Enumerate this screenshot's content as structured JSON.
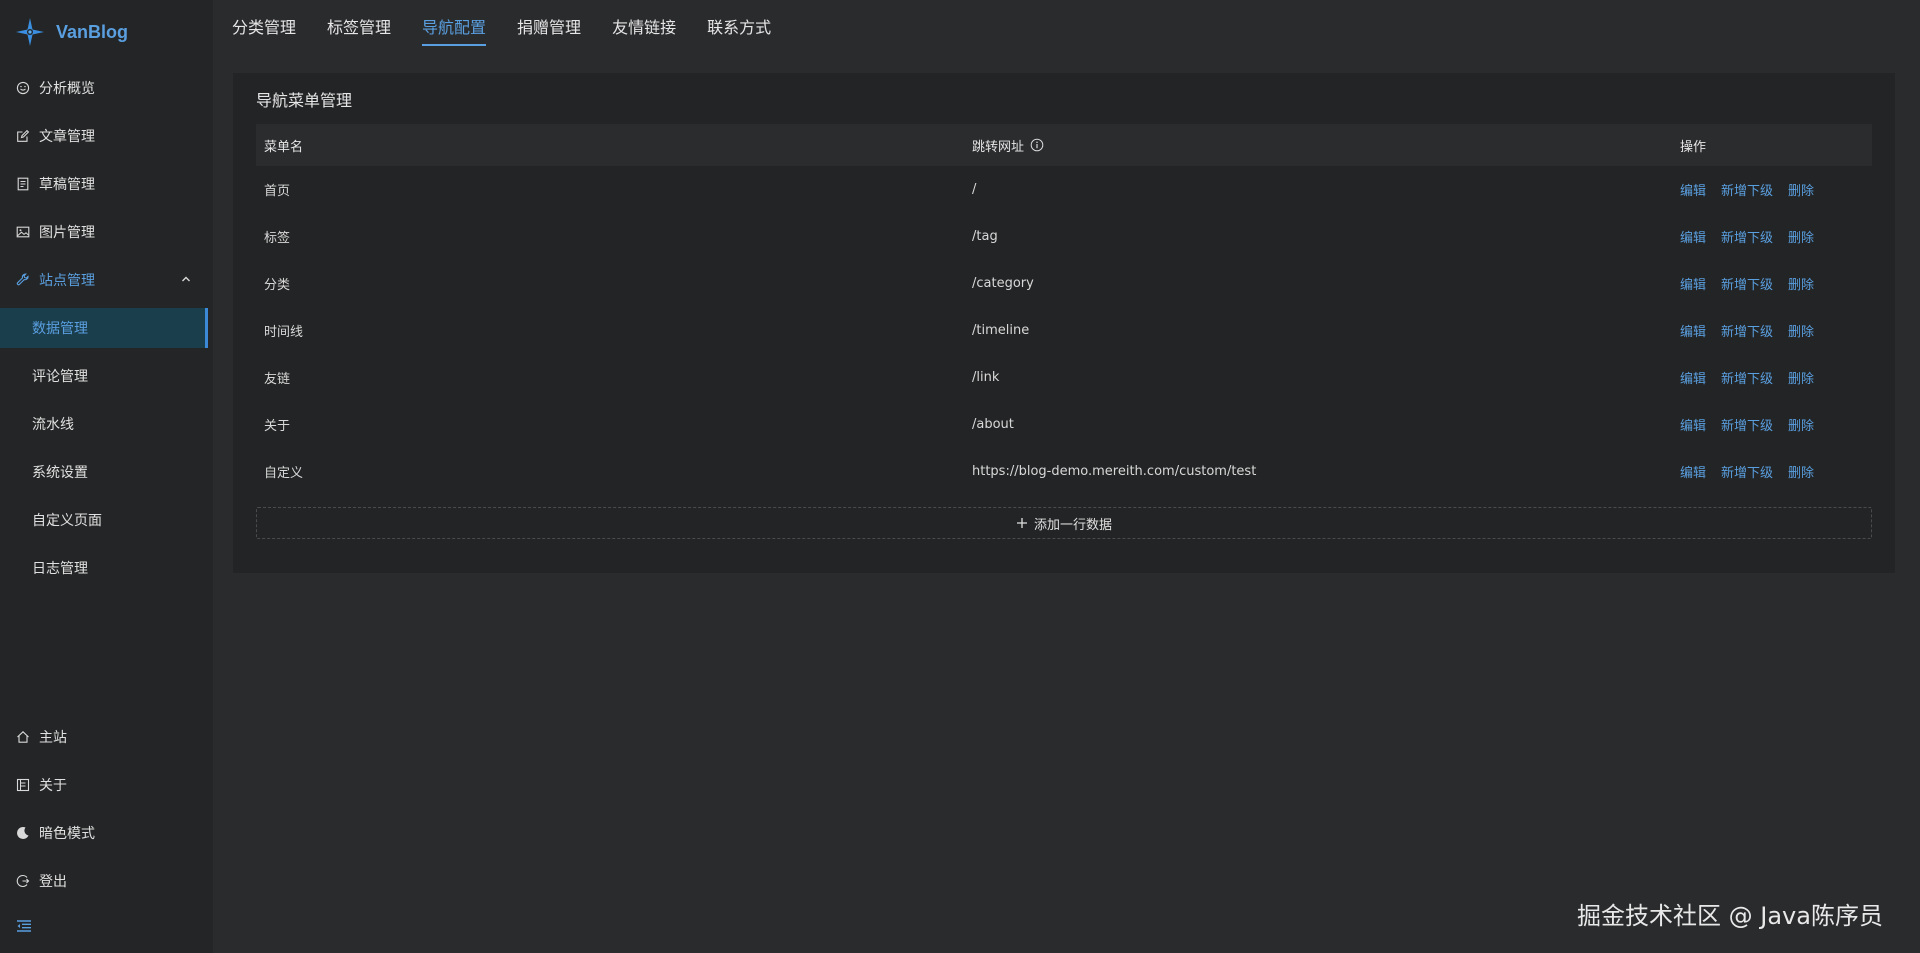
{
  "brand": {
    "name": "VanBlog"
  },
  "sidebar": {
    "items": [
      {
        "label": "分析概览",
        "icon": "dashboard-icon"
      },
      {
        "label": "文章管理",
        "icon": "edit-icon"
      },
      {
        "label": "草稿管理",
        "icon": "draft-icon"
      },
      {
        "label": "图片管理",
        "icon": "image-icon"
      },
      {
        "label": "站点管理",
        "icon": "tool-icon",
        "expanded": true
      }
    ],
    "sub_items": [
      {
        "label": "数据管理",
        "selected": true
      },
      {
        "label": "评论管理"
      },
      {
        "label": "流水线"
      },
      {
        "label": "系统设置"
      },
      {
        "label": "自定义页面"
      },
      {
        "label": "日志管理"
      }
    ],
    "bottom_items": [
      {
        "label": "主站",
        "icon": "home-icon"
      },
      {
        "label": "关于",
        "icon": "about-icon"
      },
      {
        "label": "暗色模式",
        "icon": "moon-icon"
      },
      {
        "label": "登出",
        "icon": "logout-icon"
      }
    ]
  },
  "tabs": [
    {
      "label": "分类管理"
    },
    {
      "label": "标签管理"
    },
    {
      "label": "导航配置",
      "active": true
    },
    {
      "label": "捐赠管理"
    },
    {
      "label": "友情链接"
    },
    {
      "label": "联系方式"
    }
  ],
  "card": {
    "title": "导航菜单管理",
    "columns": {
      "name": "菜单名",
      "url": "跳转网址",
      "actions": "操作"
    },
    "action_labels": {
      "edit": "编辑",
      "add_child": "新增下级",
      "delete": "删除"
    },
    "rows": [
      {
        "name": "首页",
        "url": "/"
      },
      {
        "name": "标签",
        "url": "/tag"
      },
      {
        "name": "分类",
        "url": "/category"
      },
      {
        "name": "时间线",
        "url": "/timeline"
      },
      {
        "name": "友链",
        "url": "/link"
      },
      {
        "name": "关于",
        "url": "/about"
      },
      {
        "name": "自定义",
        "url": "https://blog-demo.mereith.com/custom/test"
      }
    ],
    "add_row_label": "添加一行数据"
  },
  "watermark": "掘金技术社区 @ Java陈序员",
  "colors": {
    "accent": "#5a9fe0",
    "background": "#2a2b2d",
    "sidebar": "#242526",
    "card": "#232425"
  }
}
